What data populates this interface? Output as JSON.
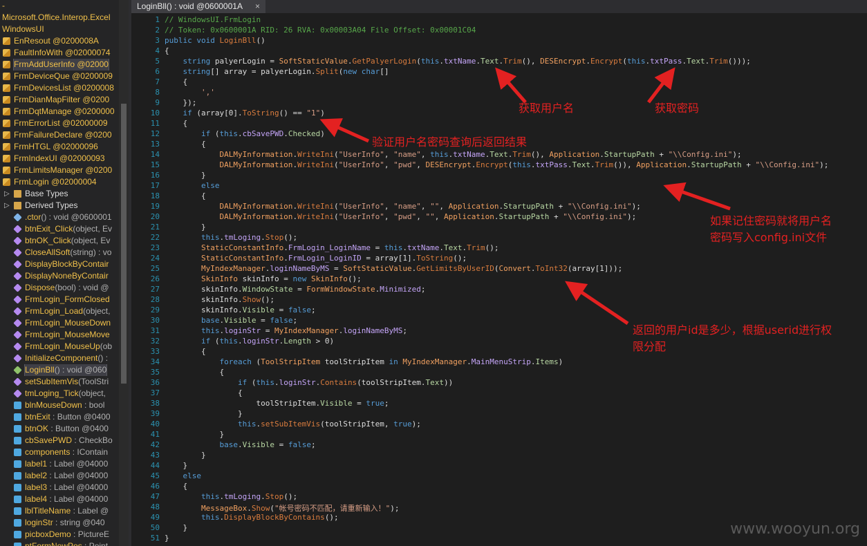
{
  "tree": {
    "header_lines": [
      "-",
      "Microsoft.Office.Interop.Excel",
      "WindowsUI"
    ],
    "items": [
      {
        "icon": "class",
        "text": "EnResout @0200008A",
        "ind": 0
      },
      {
        "icon": "class",
        "text": "FaultInfoWith @02000074",
        "ind": 0
      },
      {
        "icon": "class",
        "text": "FrmAddUserInfo @02000",
        "ind": 0,
        "sel": true
      },
      {
        "icon": "class",
        "text": "FrmDeviceQue @0200009",
        "ind": 0
      },
      {
        "icon": "class",
        "text": "FrmDevicesList @0200008",
        "ind": 0
      },
      {
        "icon": "class",
        "text": "FrmDianMapFilter @0200",
        "ind": 0
      },
      {
        "icon": "class",
        "text": "FrmDqtManage @0200000",
        "ind": 0
      },
      {
        "icon": "class",
        "text": "FrmErrorList @02000009",
        "ind": 0
      },
      {
        "icon": "class",
        "text": "FrmFailureDeclare @0200",
        "ind": 0
      },
      {
        "icon": "class",
        "text": "FrmHTGL @02000096",
        "ind": 0
      },
      {
        "icon": "class",
        "text": "FrmIndexUI @02000093",
        "ind": 0
      },
      {
        "icon": "class",
        "text": "FrmLimitsManager @0200",
        "ind": 0
      },
      {
        "icon": "class",
        "text": "FrmLogin @02000004",
        "ind": 0
      },
      {
        "icon": "folder",
        "text": "Base Types",
        "ind": 1,
        "white": true
      },
      {
        "icon": "folder",
        "text": "Derived Types",
        "ind": 1,
        "white": true
      },
      {
        "icon": "ctor",
        "text": ".ctor() : void @0600001",
        "ind": 1
      },
      {
        "icon": "method",
        "text": "btnExit_Click(object, Ev",
        "ind": 1
      },
      {
        "icon": "method",
        "text": "btnOK_Click(object, Ev",
        "ind": 1
      },
      {
        "icon": "method",
        "text": "CloseAllSoft(string) : vo",
        "ind": 1
      },
      {
        "icon": "method",
        "text": "DisplayBlockByContair",
        "ind": 1
      },
      {
        "icon": "method",
        "text": "DisplayNoneByContair",
        "ind": 1
      },
      {
        "icon": "method",
        "text": "Dispose(bool) : void @",
        "ind": 1
      },
      {
        "icon": "method",
        "text": "FrmLogin_FormClosed",
        "ind": 1
      },
      {
        "icon": "method",
        "text": "FrmLogin_Load(object,",
        "ind": 1
      },
      {
        "icon": "method",
        "text": "FrmLogin_MouseDown",
        "ind": 1
      },
      {
        "icon": "method",
        "text": "FrmLogin_MouseMove",
        "ind": 1
      },
      {
        "icon": "method",
        "text": "FrmLogin_MouseUp(ob",
        "ind": 1
      },
      {
        "icon": "method",
        "text": "InitializeComponent() :",
        "ind": 1
      },
      {
        "icon": "green",
        "text": "LoginBll() : void @060",
        "ind": 1,
        "sel": true
      },
      {
        "icon": "method",
        "text": "setSubItemVis(ToolStri",
        "ind": 1
      },
      {
        "icon": "method",
        "text": "tmLoging_Tick(object,",
        "ind": 1
      },
      {
        "icon": "field",
        "text": "blnMouseDown : bool",
        "ind": 1
      },
      {
        "icon": "field",
        "text": "btnExit : Button @0400",
        "ind": 1
      },
      {
        "icon": "field",
        "text": "btnOK : Button @0400",
        "ind": 1
      },
      {
        "icon": "field",
        "text": "cbSavePWD : CheckBo",
        "ind": 1
      },
      {
        "icon": "field",
        "text": "components : IContain",
        "ind": 1
      },
      {
        "icon": "field",
        "text": "label1 : Label @04000",
        "ind": 1
      },
      {
        "icon": "field",
        "text": "label2 : Label @04000",
        "ind": 1
      },
      {
        "icon": "field",
        "text": "label3 : Label @04000",
        "ind": 1
      },
      {
        "icon": "field",
        "text": "label4 : Label @04000",
        "ind": 1
      },
      {
        "icon": "field",
        "text": "lblTitleName : Label @",
        "ind": 1
      },
      {
        "icon": "field",
        "text": "loginStr : string @040",
        "ind": 1
      },
      {
        "icon": "field",
        "text": "picboxDemo : PictureE",
        "ind": 1
      },
      {
        "icon": "field",
        "text": "ptFormNewPos : Point",
        "ind": 1
      }
    ]
  },
  "tab": {
    "title": "LoginBll() : void @0600001A",
    "close": "×"
  },
  "code_lines": [
    [
      [
        "cm",
        "// WindowsUI.FrmLogin"
      ]
    ],
    [
      [
        "cm",
        "// Token: 0x0600001A RID: 26 RVA: 0x00003A04 File Offset: 0x00001C04"
      ]
    ],
    [
      [
        "kw",
        "public void "
      ],
      [
        "mt",
        "LoginBll"
      ],
      [
        "pl",
        "()"
      ]
    ],
    [
      [
        "pl",
        "{"
      ]
    ],
    [
      [
        "kw",
        "    string "
      ],
      [
        "pl",
        "palyerLogin = "
      ],
      [
        "cls",
        "SoftStaticValue"
      ],
      [
        "pl",
        "."
      ],
      [
        "mt",
        "GetPalyerLogin"
      ],
      [
        "pl",
        "("
      ],
      [
        "kw",
        "this"
      ],
      [
        "pl",
        "."
      ],
      [
        "pr",
        "txtName"
      ],
      [
        "pl",
        "."
      ],
      [
        "en",
        "Text"
      ],
      [
        "pl",
        "."
      ],
      [
        "mt",
        "Trim"
      ],
      [
        "pl",
        "(), "
      ],
      [
        "cls",
        "DESEncrypt"
      ],
      [
        "pl",
        "."
      ],
      [
        "mt",
        "Encrypt"
      ],
      [
        "pl",
        "("
      ],
      [
        "kw",
        "this"
      ],
      [
        "pl",
        "."
      ],
      [
        "pr",
        "txtPass"
      ],
      [
        "pl",
        "."
      ],
      [
        "en",
        "Text"
      ],
      [
        "pl",
        "."
      ],
      [
        "mt",
        "Trim"
      ],
      [
        "pl",
        "()));"
      ]
    ],
    [
      [
        "kw",
        "    string"
      ],
      [
        "pl",
        "[] array = palyerLogin."
      ],
      [
        "mt",
        "Split"
      ],
      [
        "pl",
        "("
      ],
      [
        "kw",
        "new char"
      ],
      [
        "pl",
        "[]"
      ]
    ],
    [
      [
        "pl",
        "    {"
      ]
    ],
    [
      [
        "st",
        "        ','"
      ]
    ],
    [
      [
        "pl",
        "    });"
      ]
    ],
    [
      [
        "kw",
        "    if "
      ],
      [
        "pl",
        "(array[0]."
      ],
      [
        "mt",
        "ToString"
      ],
      [
        "pl",
        "() == "
      ],
      [
        "st",
        "\"1\""
      ],
      [
        "pl",
        ")"
      ]
    ],
    [
      [
        "pl",
        "    {"
      ]
    ],
    [
      [
        "kw",
        "        if "
      ],
      [
        "pl",
        "("
      ],
      [
        "kw",
        "this"
      ],
      [
        "pl",
        "."
      ],
      [
        "pr",
        "cbSavePWD"
      ],
      [
        "pl",
        "."
      ],
      [
        "en",
        "Checked"
      ],
      [
        "pl",
        ")"
      ]
    ],
    [
      [
        "pl",
        "        {"
      ]
    ],
    [
      [
        "cls",
        "            DALMyInformation"
      ],
      [
        "pl",
        "."
      ],
      [
        "mt",
        "WriteIni"
      ],
      [
        "pl",
        "("
      ],
      [
        "st",
        "\"UserInfo\""
      ],
      [
        "pl",
        ", "
      ],
      [
        "st",
        "\"name\""
      ],
      [
        "pl",
        ", "
      ],
      [
        "kw",
        "this"
      ],
      [
        "pl",
        "."
      ],
      [
        "pr",
        "txtName"
      ],
      [
        "pl",
        "."
      ],
      [
        "en",
        "Text"
      ],
      [
        "pl",
        "."
      ],
      [
        "mt",
        "Trim"
      ],
      [
        "pl",
        "(), "
      ],
      [
        "cls",
        "Application"
      ],
      [
        "pl",
        "."
      ],
      [
        "en",
        "StartupPath"
      ],
      [
        "pl",
        " + "
      ],
      [
        "st",
        "\"\\\\Config.ini\""
      ],
      [
        "pl",
        ");"
      ]
    ],
    [
      [
        "cls",
        "            DALMyInformation"
      ],
      [
        "pl",
        "."
      ],
      [
        "mt",
        "WriteIni"
      ],
      [
        "pl",
        "("
      ],
      [
        "st",
        "\"UserInfo\""
      ],
      [
        "pl",
        ", "
      ],
      [
        "st",
        "\"pwd\""
      ],
      [
        "pl",
        ", "
      ],
      [
        "cls",
        "DESEncrypt"
      ],
      [
        "pl",
        "."
      ],
      [
        "mt",
        "Encrypt"
      ],
      [
        "pl",
        "("
      ],
      [
        "kw",
        "this"
      ],
      [
        "pl",
        "."
      ],
      [
        "pr",
        "txtPass"
      ],
      [
        "pl",
        "."
      ],
      [
        "en",
        "Text"
      ],
      [
        "pl",
        "."
      ],
      [
        "mt",
        "Trim"
      ],
      [
        "pl",
        "()), "
      ],
      [
        "cls",
        "Application"
      ],
      [
        "pl",
        "."
      ],
      [
        "en",
        "StartupPath"
      ],
      [
        "pl",
        " + "
      ],
      [
        "st",
        "\"\\\\Config.ini\""
      ],
      [
        "pl",
        ");"
      ]
    ],
    [
      [
        "pl",
        "        }"
      ]
    ],
    [
      [
        "kw",
        "        else"
      ]
    ],
    [
      [
        "pl",
        "        {"
      ]
    ],
    [
      [
        "cls",
        "            DALMyInformation"
      ],
      [
        "pl",
        "."
      ],
      [
        "mt",
        "WriteIni"
      ],
      [
        "pl",
        "("
      ],
      [
        "st",
        "\"UserInfo\""
      ],
      [
        "pl",
        ", "
      ],
      [
        "st",
        "\"name\""
      ],
      [
        "pl",
        ", "
      ],
      [
        "st",
        "\"\""
      ],
      [
        "pl",
        ", "
      ],
      [
        "cls",
        "Application"
      ],
      [
        "pl",
        "."
      ],
      [
        "en",
        "StartupPath"
      ],
      [
        "pl",
        " + "
      ],
      [
        "st",
        "\"\\\\Config.ini\""
      ],
      [
        "pl",
        ");"
      ]
    ],
    [
      [
        "cls",
        "            DALMyInformation"
      ],
      [
        "pl",
        "."
      ],
      [
        "mt",
        "WriteIni"
      ],
      [
        "pl",
        "("
      ],
      [
        "st",
        "\"UserInfo\""
      ],
      [
        "pl",
        ", "
      ],
      [
        "st",
        "\"pwd\""
      ],
      [
        "pl",
        ", "
      ],
      [
        "st",
        "\"\""
      ],
      [
        "pl",
        ", "
      ],
      [
        "cls",
        "Application"
      ],
      [
        "pl",
        "."
      ],
      [
        "en",
        "StartupPath"
      ],
      [
        "pl",
        " + "
      ],
      [
        "st",
        "\"\\\\Config.ini\""
      ],
      [
        "pl",
        ");"
      ]
    ],
    [
      [
        "pl",
        "        }"
      ]
    ],
    [
      [
        "kw",
        "        this"
      ],
      [
        "pl",
        "."
      ],
      [
        "pr",
        "tmLoging"
      ],
      [
        "pl",
        "."
      ],
      [
        "mt",
        "Stop"
      ],
      [
        "pl",
        "();"
      ]
    ],
    [
      [
        "cls",
        "        StaticConstantInfo"
      ],
      [
        "pl",
        "."
      ],
      [
        "pr",
        "FrmLogin_LoginName"
      ],
      [
        "pl",
        " = "
      ],
      [
        "kw",
        "this"
      ],
      [
        "pl",
        "."
      ],
      [
        "pr",
        "txtName"
      ],
      [
        "pl",
        "."
      ],
      [
        "en",
        "Text"
      ],
      [
        "pl",
        "."
      ],
      [
        "mt",
        "Trim"
      ],
      [
        "pl",
        "();"
      ]
    ],
    [
      [
        "cls",
        "        StaticConstantInfo"
      ],
      [
        "pl",
        "."
      ],
      [
        "pr",
        "FrmLogin_LoginID"
      ],
      [
        "pl",
        " = array[1]."
      ],
      [
        "mt",
        "ToString"
      ],
      [
        "pl",
        "();"
      ]
    ],
    [
      [
        "cls",
        "        MyIndexManager"
      ],
      [
        "pl",
        "."
      ],
      [
        "pr",
        "loginNameByMS"
      ],
      [
        "pl",
        " = "
      ],
      [
        "cls",
        "SoftStaticValue"
      ],
      [
        "pl",
        "."
      ],
      [
        "mt",
        "GetLimitsByUserID"
      ],
      [
        "pl",
        "("
      ],
      [
        "cls",
        "Convert"
      ],
      [
        "pl",
        "."
      ],
      [
        "mt",
        "ToInt32"
      ],
      [
        "pl",
        "(array[1]));"
      ]
    ],
    [
      [
        "cls",
        "        SkinInfo"
      ],
      [
        "pl",
        " skinInfo = "
      ],
      [
        "kw",
        "new "
      ],
      [
        "cls",
        "SkinInfo"
      ],
      [
        "pl",
        "();"
      ]
    ],
    [
      [
        "pl",
        "        skinInfo."
      ],
      [
        "en",
        "WindowState"
      ],
      [
        "pl",
        " = "
      ],
      [
        "cls",
        "FormWindowState"
      ],
      [
        "pl",
        "."
      ],
      [
        "pr",
        "Minimized"
      ],
      [
        "pl",
        ";"
      ]
    ],
    [
      [
        "pl",
        "        skinInfo."
      ],
      [
        "mt",
        "Show"
      ],
      [
        "pl",
        "();"
      ]
    ],
    [
      [
        "pl",
        "        skinInfo."
      ],
      [
        "en",
        "Visible"
      ],
      [
        "pl",
        " = "
      ],
      [
        "kw",
        "false"
      ],
      [
        "pl",
        ";"
      ]
    ],
    [
      [
        "kw",
        "        base"
      ],
      [
        "pl",
        "."
      ],
      [
        "en",
        "Visible"
      ],
      [
        "pl",
        " = "
      ],
      [
        "kw",
        "false"
      ],
      [
        "pl",
        ";"
      ]
    ],
    [
      [
        "kw",
        "        this"
      ],
      [
        "pl",
        "."
      ],
      [
        "pr",
        "loginStr"
      ],
      [
        "pl",
        " = "
      ],
      [
        "cls",
        "MyIndexManager"
      ],
      [
        "pl",
        "."
      ],
      [
        "pr",
        "loginNameByMS"
      ],
      [
        "pl",
        ";"
      ]
    ],
    [
      [
        "kw",
        "        if "
      ],
      [
        "pl",
        "("
      ],
      [
        "kw",
        "this"
      ],
      [
        "pl",
        "."
      ],
      [
        "pr",
        "loginStr"
      ],
      [
        "pl",
        "."
      ],
      [
        "en",
        "Length"
      ],
      [
        "pl",
        " > 0)"
      ]
    ],
    [
      [
        "pl",
        "        {"
      ]
    ],
    [
      [
        "kw",
        "            foreach "
      ],
      [
        "pl",
        "("
      ],
      [
        "cls",
        "ToolStripItem"
      ],
      [
        "pl",
        " toolStripItem "
      ],
      [
        "kw",
        "in "
      ],
      [
        "cls",
        "MyIndexManager"
      ],
      [
        "pl",
        "."
      ],
      [
        "pr",
        "MainMenuStrip"
      ],
      [
        "pl",
        "."
      ],
      [
        "en",
        "Items"
      ],
      [
        "pl",
        ")"
      ]
    ],
    [
      [
        "pl",
        "            {"
      ]
    ],
    [
      [
        "kw",
        "                if "
      ],
      [
        "pl",
        "("
      ],
      [
        "kw",
        "this"
      ],
      [
        "pl",
        "."
      ],
      [
        "pr",
        "loginStr"
      ],
      [
        "pl",
        "."
      ],
      [
        "mt",
        "Contains"
      ],
      [
        "pl",
        "(toolStripItem."
      ],
      [
        "en",
        "Text"
      ],
      [
        "pl",
        "))"
      ]
    ],
    [
      [
        "pl",
        "                {"
      ]
    ],
    [
      [
        "pl",
        "                    toolStripItem."
      ],
      [
        "en",
        "Visible"
      ],
      [
        "pl",
        " = "
      ],
      [
        "kw",
        "true"
      ],
      [
        "pl",
        ";"
      ]
    ],
    [
      [
        "pl",
        "                }"
      ]
    ],
    [
      [
        "kw",
        "                this"
      ],
      [
        "pl",
        "."
      ],
      [
        "mt",
        "setSubItemVis"
      ],
      [
        "pl",
        "(toolStripItem, "
      ],
      [
        "kw",
        "true"
      ],
      [
        "pl",
        ");"
      ]
    ],
    [
      [
        "pl",
        "            }"
      ]
    ],
    [
      [
        "kw",
        "            base"
      ],
      [
        "pl",
        "."
      ],
      [
        "en",
        "Visible"
      ],
      [
        "pl",
        " = "
      ],
      [
        "kw",
        "false"
      ],
      [
        "pl",
        ";"
      ]
    ],
    [
      [
        "pl",
        "        }"
      ]
    ],
    [
      [
        "pl",
        "    }"
      ]
    ],
    [
      [
        "kw",
        "    else"
      ]
    ],
    [
      [
        "pl",
        "    {"
      ]
    ],
    [
      [
        "kw",
        "        this"
      ],
      [
        "pl",
        "."
      ],
      [
        "pr",
        "tmLoging"
      ],
      [
        "pl",
        "."
      ],
      [
        "mt",
        "Stop"
      ],
      [
        "pl",
        "();"
      ]
    ],
    [
      [
        "cls",
        "        MessageBox"
      ],
      [
        "pl",
        "."
      ],
      [
        "mt",
        "Show"
      ],
      [
        "pl",
        "("
      ],
      [
        "st",
        "\"帐号密码不匹配，请重新输入！\""
      ],
      [
        "pl",
        ");"
      ]
    ],
    [
      [
        "kw",
        "        this"
      ],
      [
        "pl",
        "."
      ],
      [
        "mt",
        "DisplayBlockByContains"
      ],
      [
        "pl",
        "();"
      ]
    ],
    [
      [
        "pl",
        "    }"
      ]
    ],
    [
      [
        "pl",
        "}"
      ]
    ]
  ],
  "annotations": {
    "get_username": "获取用户名",
    "get_password": "获取密码",
    "verify": "验证用户名密码查询后返回结果",
    "remember_1": "如果记住密码就将用户名",
    "remember_2": "密码写入config.ini文件",
    "return_1": "返回的用户id是多少，根据userid进行权",
    "return_2": "限分配"
  },
  "watermark": "www.wooyun.org",
  "colors": {
    "annotation": "#e32121",
    "line_number": "#2b91af",
    "background": "#1e1e1e"
  }
}
